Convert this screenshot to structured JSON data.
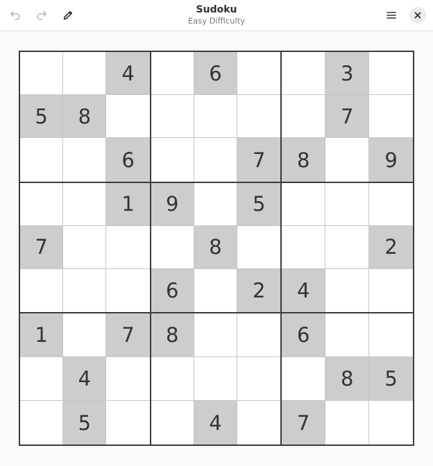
{
  "header": {
    "title": "Sudoku",
    "subtitle": "Easy Difficulty",
    "icons": {
      "undo": "undo-icon",
      "redo": "redo-icon",
      "notes": "pencil-icon",
      "menu": "hamburger-menu-icon",
      "close": "close-icon"
    }
  },
  "board": {
    "rows": [
      [
        "",
        "",
        "4",
        "",
        "6",
        "",
        "",
        "3",
        ""
      ],
      [
        "5",
        "8",
        "",
        "",
        "",
        "",
        "",
        "7",
        ""
      ],
      [
        "",
        "",
        "6",
        "",
        "",
        "7",
        "8",
        "",
        "9"
      ],
      [
        "",
        "",
        "1",
        "9",
        "",
        "5",
        "",
        "",
        ""
      ],
      [
        "7",
        "",
        "",
        "",
        "8",
        "",
        "",
        "",
        "2"
      ],
      [
        "",
        "",
        "",
        "6",
        "",
        "2",
        "4",
        "",
        ""
      ],
      [
        "1",
        "",
        "7",
        "8",
        "",
        "",
        "6",
        "",
        ""
      ],
      [
        "",
        "4",
        "",
        "",
        "",
        "",
        "",
        "8",
        "5"
      ],
      [
        "",
        "5",
        "",
        "",
        "4",
        "",
        "7",
        "",
        ""
      ]
    ]
  },
  "colors": {
    "given_cell": "#cdcdcd",
    "empty_cell": "#ffffff",
    "box_border": "#3a3a3a",
    "cell_border": "#c6c6c6"
  }
}
